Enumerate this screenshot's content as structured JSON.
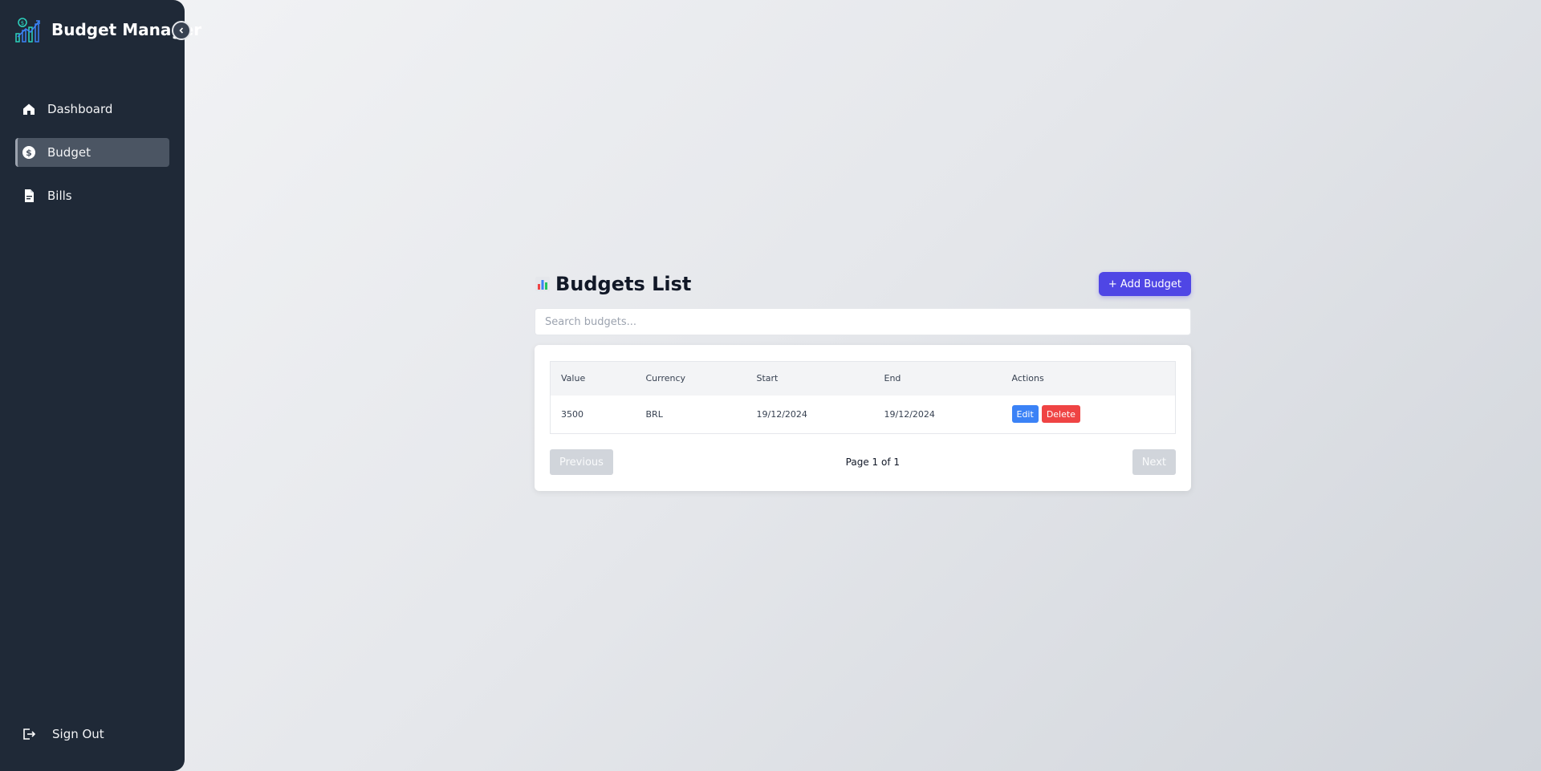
{
  "sidebar": {
    "brand": "Budget Manager",
    "items": [
      {
        "label": "Dashboard",
        "icon": "home-icon"
      },
      {
        "label": "Budget",
        "icon": "dollar-circle-icon",
        "active": true
      },
      {
        "label": "Bills",
        "icon": "document-icon"
      }
    ],
    "signout": "Sign Out"
  },
  "main": {
    "title": "Budgets List",
    "add_button": "+ Add Budget",
    "search_placeholder": "Search budgets...",
    "table": {
      "headers": [
        "Value",
        "Currency",
        "Start",
        "End",
        "Actions"
      ],
      "rows": [
        {
          "value": "3500",
          "currency": "BRL",
          "start": "19/12/2024",
          "end": "19/12/2024"
        }
      ],
      "actions": {
        "edit": "Edit",
        "delete": "Delete"
      }
    },
    "pagination": {
      "previous": "Previous",
      "info": "Page 1 of 1",
      "next": "Next"
    }
  },
  "colors": {
    "sidebar_bg": "#1f2937",
    "primary": "#4f46e5",
    "edit": "#3b82f6",
    "delete": "#ef4444"
  }
}
